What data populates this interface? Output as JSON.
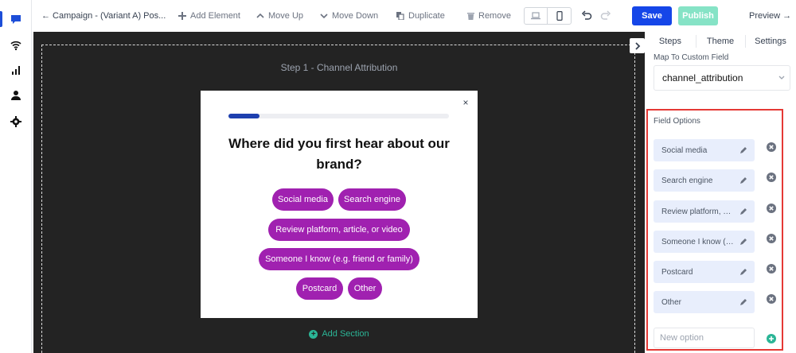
{
  "toolbar": {
    "back_title": "← Campaign - (Variant A) Pos...",
    "add_element": "Add Element",
    "move_up": "Move Up",
    "move_down": "Move Down",
    "duplicate": "Duplicate",
    "remove": "Remove",
    "save": "Save",
    "publish": "Publish",
    "preview": "Preview →"
  },
  "rail": {
    "icons": [
      "chat-icon",
      "wifi-icon",
      "chart-icon",
      "user-icon",
      "gear-icon"
    ]
  },
  "canvas": {
    "step_title": "Step 1 - Channel Attribution",
    "close": "×",
    "progress": 0.14,
    "question": "Where did you first hear about our brand?",
    "options": [
      "Social media",
      "Search engine",
      "Review platform, article, or video",
      "Someone I know (e.g. friend or family)",
      "Postcard",
      "Other"
    ],
    "add_section": "Add Section"
  },
  "panel": {
    "tabs": [
      "Steps",
      "Theme",
      "Settings"
    ],
    "map_label": "Map To Custom Field",
    "map_value": "channel_attribution",
    "field_options_label": "Field Options",
    "field_options": [
      "Social media",
      "Search engine",
      "Review platform, article, or video",
      "Someone I know (e.g. friend or family)",
      "Postcard",
      "Other"
    ],
    "new_option_placeholder": "New option"
  },
  "colors": {
    "accent": "#1546e8",
    "publish": "#86e3c6",
    "option_pill": "#a021b0",
    "highlight": "#e53935",
    "success": "#2bb596"
  }
}
